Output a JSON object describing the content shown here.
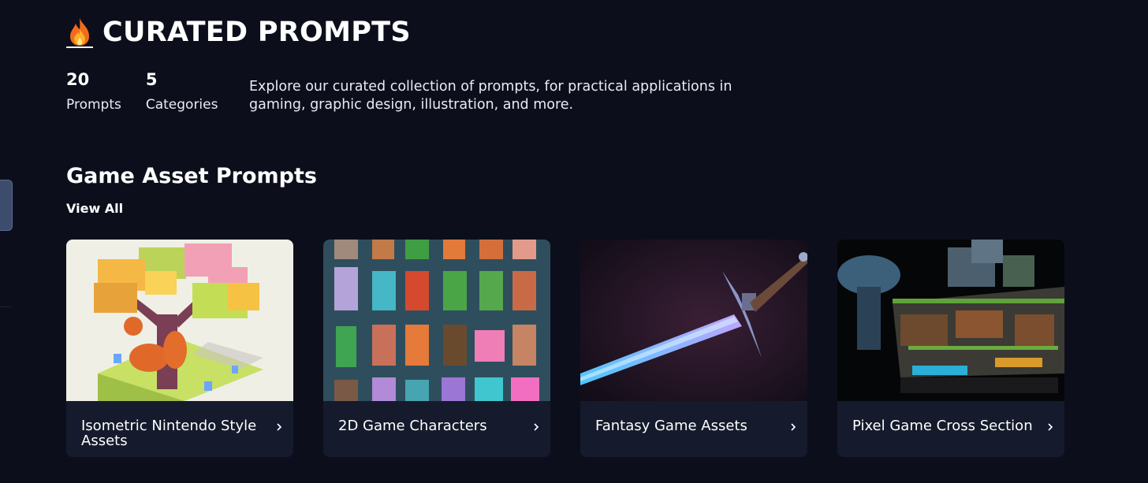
{
  "header": {
    "title": "CURATED PROMPTS",
    "icon": "fire-icon"
  },
  "stats": [
    {
      "value": "20",
      "label": "Prompts"
    },
    {
      "value": "5",
      "label": "Categories"
    }
  ],
  "intro": "Explore our curated collection of prompts, for practical applications in gaming, graphic design, illustration, and more.",
  "section": {
    "title": "Game Asset Prompts",
    "view_all": "View All"
  },
  "cards": [
    {
      "label": "Isometric Nintendo Style Assets",
      "image": "isometric-tree-squirrel-image"
    },
    {
      "label": "2D Game Characters",
      "image": "pixel-characters-grid-image"
    },
    {
      "label": "Fantasy Game Assets",
      "image": "fantasy-sword-image"
    },
    {
      "label": "Pixel Game Cross Section",
      "image": "pixel-cross-section-image"
    }
  ],
  "colors": {
    "background": "#0c0f1b",
    "card": "#151b2c",
    "text": "#ffffff"
  }
}
